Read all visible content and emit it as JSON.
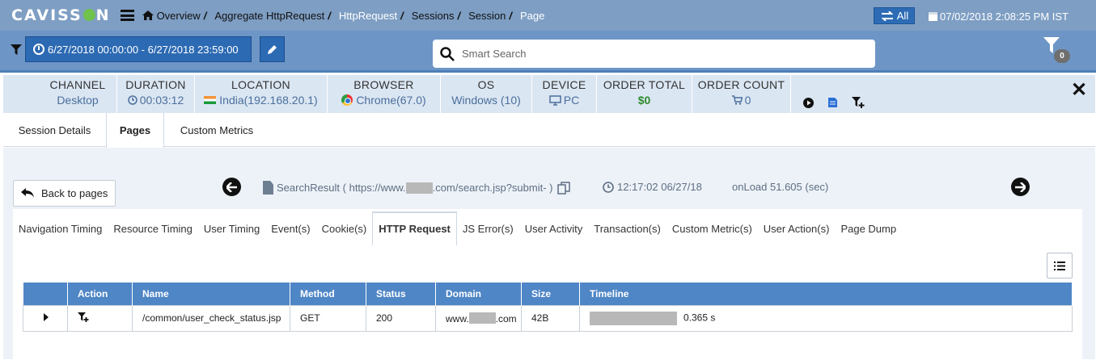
{
  "app": {
    "logo": "CAVISS",
    "logo_tail": "N",
    "breadcrumbs": [
      "Overview",
      "Aggregate HttpRequest",
      "HttpRequest",
      "Sessions",
      "Session",
      "Page"
    ],
    "all_label": "All",
    "datetime": "07/02/2018 2:08:25 PM IST"
  },
  "filter": {
    "date_range": "6/27/2018 00:00:00 - 6/27/2018 23:59:00",
    "search_placeholder": "Smart Search",
    "filter_count": "0"
  },
  "session_info": {
    "channel": {
      "label": "CHANNEL",
      "value": "Desktop"
    },
    "duration": {
      "label": "DURATION",
      "value": "00:03:12"
    },
    "location": {
      "label": "LOCATION",
      "value": "India(192.168.20.1)"
    },
    "browser": {
      "label": "BROWSER",
      "value": "Chrome(67.0)"
    },
    "os": {
      "label": "OS",
      "value": "Windows (10)"
    },
    "device": {
      "label": "DEVICE",
      "value": "PC"
    },
    "order_total": {
      "label": "ORDER TOTAL",
      "value": "$0"
    },
    "order_count": {
      "label": "ORDER COUNT",
      "value": "0"
    }
  },
  "main_tabs": [
    "Session Details",
    "Pages",
    "Custom Metrics"
  ],
  "page_nav": {
    "back_label": "Back to pages",
    "page_name_prefix": "SearchResult ( https://www.",
    "page_name_suffix": ".com/search.jsp?submit- )",
    "timestamp": "12:17:02 06/27/18",
    "onload": "onLoad 51.605 (sec)"
  },
  "sub_tabs": [
    "Navigation Timing",
    "Resource Timing",
    "User Timing",
    "Event(s)",
    "Cookie(s)",
    "HTTP Request",
    "JS Error(s)",
    "User Activity",
    "Transaction(s)",
    "Custom Metric(s)",
    "User Action(s)",
    "Page Dump"
  ],
  "table": {
    "headers": [
      "",
      "Action",
      "Name",
      "Method",
      "Status",
      "Domain",
      "Size",
      "Timeline"
    ],
    "rows": [
      {
        "name": "/common/user_check_status.jsp",
        "method": "GET",
        "status": "200",
        "domain_prefix": "www.",
        "domain_suffix": ".com",
        "size": "42B",
        "timeline": "0.365 s"
      }
    ]
  },
  "colors": {
    "topbar": "#7e9ec3",
    "filterbar": "#6d95c5",
    "accent": "#2c6ab3",
    "table_header": "#4f86c6"
  }
}
